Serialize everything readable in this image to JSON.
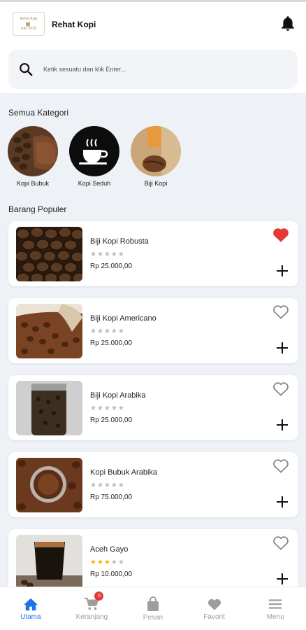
{
  "header": {
    "logo_lines": [
      "Rehat Kopi",
      "Est. 2019"
    ],
    "title": "Rehat Kopi",
    "notification_icon": "bell-icon"
  },
  "search": {
    "placeholder": "Ketik sesuatu dan klik Enter..."
  },
  "categories": {
    "title": "Semua Kategori",
    "items": [
      {
        "label": "Kopi Bubuk"
      },
      {
        "label": "Kopi Seduh"
      },
      {
        "label": "Biji Kopi"
      }
    ]
  },
  "popular": {
    "title": "Barang Populer",
    "items": [
      {
        "name": "Biji Kopi Robusta",
        "price": "Rp 25.000,00",
        "rating": 0,
        "favorite": true
      },
      {
        "name": "Biji Kopi Americano",
        "price": "Rp 25.000,00",
        "rating": 0,
        "favorite": false
      },
      {
        "name": "Biji Kopi Arabika",
        "price": "Rp 25.000,00",
        "rating": 0,
        "favorite": false
      },
      {
        "name": "Kopi Bubuk Arabika",
        "price": "Rp 75.000,00",
        "rating": 0,
        "favorite": false
      },
      {
        "name": "Aceh Gayo",
        "price": "Rp 10.000,00",
        "rating": 3,
        "favorite": false
      }
    ]
  },
  "nav": {
    "items": [
      {
        "label": "Utama",
        "icon": "home-icon",
        "active": true
      },
      {
        "label": "Keranjang",
        "icon": "cart-icon",
        "badge": "0"
      },
      {
        "label": "Pesan",
        "icon": "bag-icon"
      },
      {
        "label": "Favorit",
        "icon": "heart-icon"
      },
      {
        "label": "Menu",
        "icon": "menu-icon"
      }
    ]
  },
  "colors": {
    "accent": "#1e73e8",
    "favorite": "#e53935",
    "star": "#f0b400"
  }
}
